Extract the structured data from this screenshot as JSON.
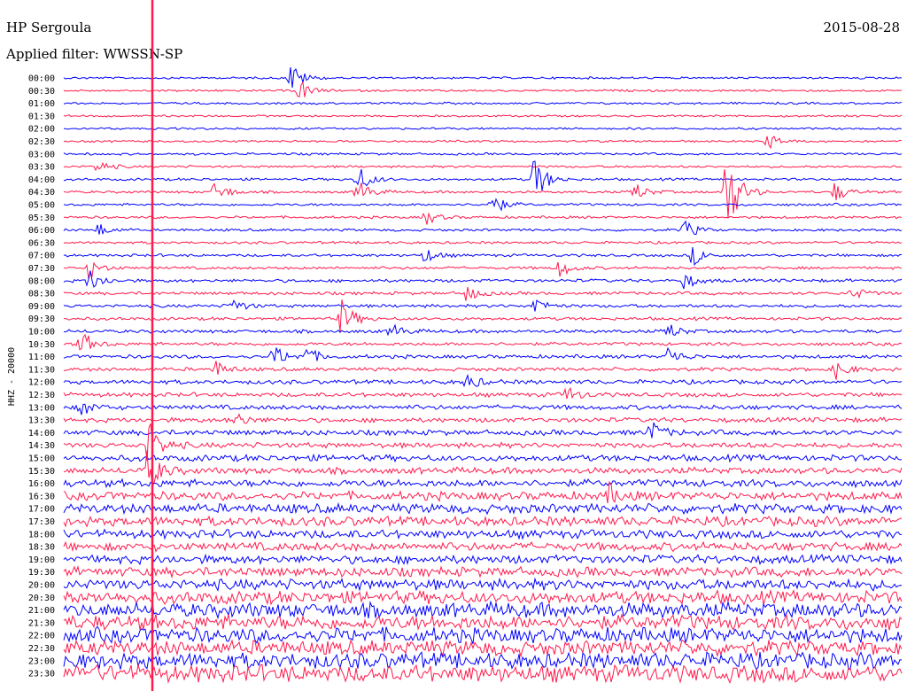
{
  "header": {
    "station": "HP Sergoula",
    "date": "2015-08-28",
    "filter_label": "Applied filter: WWSSN-SP"
  },
  "chart_data": {
    "type": "line",
    "title": "HP Sergoula",
    "subtitle": "Applied filter: WWSSN-SP",
    "ylabel": "HHZ - 20000",
    "xlabel": "",
    "grid": false,
    "legend": "none",
    "colors": [
      "#0000ff",
      "#ff1a4d"
    ],
    "row_labels": [
      "00:00",
      "00:30",
      "01:00",
      "01:30",
      "02:00",
      "02:30",
      "03:00",
      "03:30",
      "04:00",
      "04:30",
      "05:00",
      "05:30",
      "06:00",
      "06:30",
      "07:00",
      "07:30",
      "08:00",
      "08:30",
      "09:00",
      "09:30",
      "10:00",
      "10:30",
      "11:00",
      "11:30",
      "12:00",
      "12:30",
      "13:00",
      "13:30",
      "14:00",
      "14:30",
      "15:00",
      "15:30",
      "16:00",
      "16:30",
      "17:00",
      "17:30",
      "18:00",
      "18:30",
      "19:00",
      "19:30",
      "20:00",
      "20:30",
      "21:00",
      "21:30",
      "22:00",
      "22:30",
      "23:00",
      "23:30"
    ],
    "noise_levels": [
      1,
      1,
      1,
      1,
      1,
      1,
      1.1,
      1.1,
      1.2,
      1.2,
      1.2,
      1.2,
      1.2,
      1.2,
      1.3,
      1.3,
      1.5,
      1.5,
      1.5,
      1.5,
      1.6,
      1.6,
      1.7,
      1.7,
      2,
      2,
      2.2,
      2.2,
      2.5,
      2.5,
      3,
      3,
      3.5,
      4,
      4.5,
      4.5,
      4,
      4,
      4,
      4.5,
      5,
      6,
      7,
      7,
      7,
      7,
      7.5,
      8
    ],
    "events": [
      {
        "row": 0,
        "t": 0.27,
        "amp": 20
      },
      {
        "row": 1,
        "t": 0.28,
        "amp": 14
      },
      {
        "row": 5,
        "t": 0.84,
        "amp": 10
      },
      {
        "row": 7,
        "t": 0.04,
        "amp": 8
      },
      {
        "row": 8,
        "t": 0.56,
        "amp": 30
      },
      {
        "row": 8,
        "t": 0.35,
        "amp": 18
      },
      {
        "row": 9,
        "t": 0.18,
        "amp": 14
      },
      {
        "row": 9,
        "t": 0.35,
        "amp": 16
      },
      {
        "row": 9,
        "t": 0.68,
        "amp": 12
      },
      {
        "row": 9,
        "t": 0.79,
        "amp": 60
      },
      {
        "row": 9,
        "t": 0.92,
        "amp": 12
      },
      {
        "row": 10,
        "t": 0.51,
        "amp": 14
      },
      {
        "row": 11,
        "t": 0.43,
        "amp": 10
      },
      {
        "row": 12,
        "t": 0.04,
        "amp": 8
      },
      {
        "row": 12,
        "t": 0.74,
        "amp": 12
      },
      {
        "row": 14,
        "t": 0.43,
        "amp": 9
      },
      {
        "row": 14,
        "t": 0.75,
        "amp": 12
      },
      {
        "row": 15,
        "t": 0.03,
        "amp": 12
      },
      {
        "row": 15,
        "t": 0.59,
        "amp": 12
      },
      {
        "row": 16,
        "t": 0.03,
        "amp": 14
      },
      {
        "row": 16,
        "t": 0.74,
        "amp": 10
      },
      {
        "row": 17,
        "t": 0.48,
        "amp": 10
      },
      {
        "row": 17,
        "t": 0.94,
        "amp": 8
      },
      {
        "row": 18,
        "t": 0.2,
        "amp": 10
      },
      {
        "row": 18,
        "t": 0.56,
        "amp": 12
      },
      {
        "row": 19,
        "t": 0.33,
        "amp": 24
      },
      {
        "row": 20,
        "t": 0.39,
        "amp": 10
      },
      {
        "row": 20,
        "t": 0.72,
        "amp": 10
      },
      {
        "row": 21,
        "t": 0.02,
        "amp": 16
      },
      {
        "row": 22,
        "t": 0.25,
        "amp": 14
      },
      {
        "row": 22,
        "t": 0.29,
        "amp": 10
      },
      {
        "row": 22,
        "t": 0.72,
        "amp": 12
      },
      {
        "row": 23,
        "t": 0.18,
        "amp": 10
      },
      {
        "row": 23,
        "t": 0.92,
        "amp": 12
      },
      {
        "row": 24,
        "t": 0.48,
        "amp": 10
      },
      {
        "row": 25,
        "t": 0.6,
        "amp": 10
      },
      {
        "row": 26,
        "t": 0.02,
        "amp": 10
      },
      {
        "row": 27,
        "t": 0.2,
        "amp": 12
      },
      {
        "row": 28,
        "t": 0.7,
        "amp": 14
      },
      {
        "row": 29,
        "t": 0.1,
        "amp": 30
      },
      {
        "row": 31,
        "t": 0.1,
        "amp": 26
      },
      {
        "row": 33,
        "t": 0.65,
        "amp": 12
      }
    ]
  }
}
